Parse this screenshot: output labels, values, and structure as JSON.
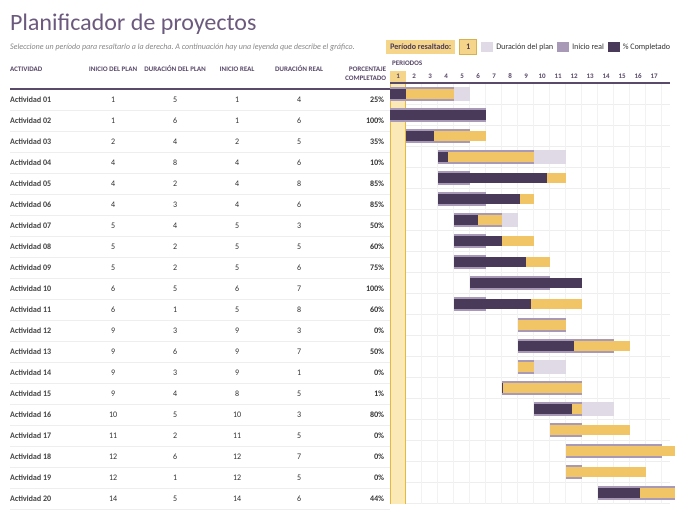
{
  "title": "Planificador de proyectos",
  "subtitle": "Seleccione un período para resaltarlo a la derecha.  A continuación hay una leyenda que describe el gráfico.",
  "legend": {
    "period_highlight_label": "Período resaltado:",
    "period_highlight_value": "1",
    "plan_duration": "Duración del plan",
    "real_start": "Inicio real",
    "pct_complete": "% Completado"
  },
  "headers": {
    "activity": "ACTIVIDAD",
    "plan_start": "INICIO DEL PLAN",
    "plan_dur": "DURACIÓN DEL PLAN",
    "real_start": "INICIO REAL",
    "real_dur": "DURACIÓN REAL",
    "pct": "PORCENTAJE COMPLETADO",
    "periods": "PERIODOS"
  },
  "periods": [
    "1",
    "2",
    "3",
    "4",
    "5",
    "6",
    "7",
    "8",
    "9",
    "10",
    "11",
    "12",
    "13",
    "14",
    "15",
    "16",
    "17"
  ],
  "highlight_period": 1,
  "rows": [
    {
      "act": "Actividad 01",
      "ps": 1,
      "pd": 5,
      "rs": 1,
      "rd": 4,
      "pct": "25%",
      "pctv": 0.25
    },
    {
      "act": "Actividad 02",
      "ps": 1,
      "pd": 6,
      "rs": 1,
      "rd": 6,
      "pct": "100%",
      "pctv": 1.0
    },
    {
      "act": "Actividad 03",
      "ps": 2,
      "pd": 4,
      "rs": 2,
      "rd": 5,
      "pct": "35%",
      "pctv": 0.35
    },
    {
      "act": "Actividad 04",
      "ps": 4,
      "pd": 8,
      "rs": 4,
      "rd": 6,
      "pct": "10%",
      "pctv": 0.1
    },
    {
      "act": "Actividad 05",
      "ps": 4,
      "pd": 2,
      "rs": 4,
      "rd": 8,
      "pct": "85%",
      "pctv": 0.85
    },
    {
      "act": "Actividad 06",
      "ps": 4,
      "pd": 3,
      "rs": 4,
      "rd": 6,
      "pct": "85%",
      "pctv": 0.85
    },
    {
      "act": "Actividad 07",
      "ps": 5,
      "pd": 4,
      "rs": 5,
      "rd": 3,
      "pct": "50%",
      "pctv": 0.5
    },
    {
      "act": "Actividad 08",
      "ps": 5,
      "pd": 2,
      "rs": 5,
      "rd": 5,
      "pct": "60%",
      "pctv": 0.6
    },
    {
      "act": "Actividad 09",
      "ps": 5,
      "pd": 2,
      "rs": 5,
      "rd": 6,
      "pct": "75%",
      "pctv": 0.75
    },
    {
      "act": "Actividad 10",
      "ps": 6,
      "pd": 5,
      "rs": 6,
      "rd": 7,
      "pct": "100%",
      "pctv": 1.0
    },
    {
      "act": "Actividad 11",
      "ps": 6,
      "pd": 1,
      "rs": 5,
      "rd": 8,
      "pct": "60%",
      "pctv": 0.6
    },
    {
      "act": "Actividad 12",
      "ps": 9,
      "pd": 3,
      "rs": 9,
      "rd": 3,
      "pct": "0%",
      "pctv": 0.0
    },
    {
      "act": "Actividad 13",
      "ps": 9,
      "pd": 6,
      "rs": 9,
      "rd": 7,
      "pct": "50%",
      "pctv": 0.5
    },
    {
      "act": "Actividad 14",
      "ps": 9,
      "pd": 3,
      "rs": 9,
      "rd": 1,
      "pct": "0%",
      "pctv": 0.0
    },
    {
      "act": "Actividad 15",
      "ps": 9,
      "pd": 4,
      "rs": 8,
      "rd": 5,
      "pct": "1%",
      "pctv": 0.01
    },
    {
      "act": "Actividad 16",
      "ps": 10,
      "pd": 5,
      "rs": 10,
      "rd": 3,
      "pct": "80%",
      "pctv": 0.8
    },
    {
      "act": "Actividad 17",
      "ps": 11,
      "pd": 2,
      "rs": 11,
      "rd": 5,
      "pct": "0%",
      "pctv": 0.0
    },
    {
      "act": "Actividad 18",
      "ps": 12,
      "pd": 6,
      "rs": 12,
      "rd": 7,
      "pct": "0%",
      "pctv": 0.0
    },
    {
      "act": "Actividad 19",
      "ps": 12,
      "pd": 1,
      "rs": 12,
      "rd": 5,
      "pct": "0%",
      "pctv": 0.0
    },
    {
      "act": "Actividad 20",
      "ps": 14,
      "pd": 5,
      "rs": 14,
      "rd": 6,
      "pct": "44%",
      "pctv": 0.44
    }
  ],
  "chart_data": {
    "type": "bar",
    "title": "Planificador de proyectos",
    "xlabel": "PERIODOS",
    "ylabel": "ACTIVIDAD",
    "x": [
      1,
      2,
      3,
      4,
      5,
      6,
      7,
      8,
      9,
      10,
      11,
      12,
      13,
      14,
      15,
      16,
      17
    ],
    "categories": [
      "Actividad 01",
      "Actividad 02",
      "Actividad 03",
      "Actividad 04",
      "Actividad 05",
      "Actividad 06",
      "Actividad 07",
      "Actividad 08",
      "Actividad 09",
      "Actividad 10",
      "Actividad 11",
      "Actividad 12",
      "Actividad 13",
      "Actividad 14",
      "Actividad 15",
      "Actividad 16",
      "Actividad 17",
      "Actividad 18",
      "Actividad 19",
      "Actividad 20"
    ],
    "series": [
      {
        "name": "Inicio del plan",
        "values": [
          1,
          1,
          2,
          4,
          4,
          4,
          5,
          5,
          5,
          6,
          6,
          9,
          9,
          9,
          9,
          10,
          11,
          12,
          12,
          14
        ]
      },
      {
        "name": "Duración del plan",
        "values": [
          5,
          6,
          4,
          8,
          2,
          3,
          4,
          2,
          2,
          5,
          1,
          3,
          6,
          3,
          4,
          5,
          2,
          6,
          1,
          5
        ]
      },
      {
        "name": "Inicio real",
        "values": [
          1,
          1,
          2,
          4,
          4,
          4,
          5,
          5,
          5,
          6,
          5,
          9,
          9,
          9,
          8,
          10,
          11,
          12,
          12,
          14
        ]
      },
      {
        "name": "Duración real",
        "values": [
          4,
          6,
          5,
          6,
          8,
          6,
          3,
          5,
          6,
          7,
          8,
          3,
          7,
          1,
          5,
          3,
          5,
          7,
          5,
          6
        ]
      },
      {
        "name": "% Completado",
        "values": [
          25,
          100,
          35,
          10,
          85,
          85,
          50,
          60,
          75,
          100,
          60,
          0,
          50,
          0,
          1,
          80,
          0,
          0,
          0,
          44
        ]
      }
    ],
    "xlim": [
      1,
      17
    ]
  }
}
